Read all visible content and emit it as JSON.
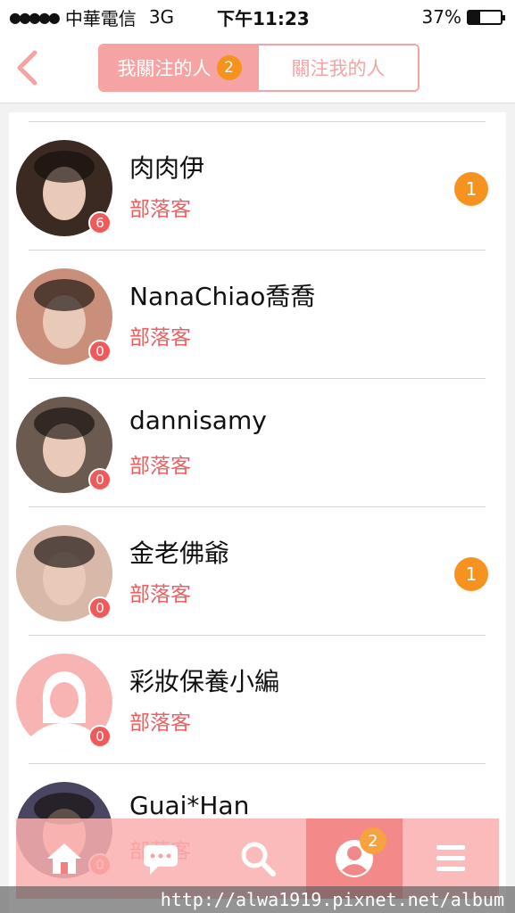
{
  "status_bar": {
    "signal_dots": "●●●●●",
    "carrier": "中華電信",
    "network": "3G",
    "time": "下午11:23",
    "battery_percent": "37%",
    "battery_level": 0.37
  },
  "header": {
    "tabs": [
      {
        "label": "我關注的人",
        "badge": "2",
        "active": true
      },
      {
        "label": "關注我的人",
        "active": false
      }
    ]
  },
  "list": [
    {
      "name": "肉肉伊",
      "role": "部落客",
      "count": "6",
      "notification": "1",
      "avatar_color": "#3a2a22"
    },
    {
      "name": "NanaChiao喬喬",
      "role": "部落客",
      "count": "0",
      "notification": null,
      "avatar_color": "#c98f7a"
    },
    {
      "name": "dannisamy",
      "role": "部落客",
      "count": "0",
      "notification": null,
      "avatar_color": "#6b5a50"
    },
    {
      "name": "金老佛爺",
      "role": "部落客",
      "count": "0",
      "notification": "1",
      "avatar_color": "#d8b8a8"
    },
    {
      "name": "彩妝保養小編",
      "role": "部落客",
      "count": "0",
      "notification": null,
      "avatar_color": "#f7b4b2"
    },
    {
      "name": "Guai*Han",
      "role": "部落客",
      "count": "0",
      "notification": null,
      "avatar_color": "#4a4560"
    }
  ],
  "tab_bar": {
    "items": [
      {
        "icon": "home-icon",
        "active": false
      },
      {
        "icon": "chat-icon",
        "active": false
      },
      {
        "icon": "search-icon",
        "active": false
      },
      {
        "icon": "profile-icon",
        "active": true,
        "badge": "2"
      },
      {
        "icon": "menu-icon",
        "active": false
      }
    ]
  },
  "watermark": "http://alwa1919.pixnet.net/album",
  "colors": {
    "accent": "#f5a3a3",
    "role_text": "#ee6060",
    "badge_orange": "#f6921e",
    "count_badge": "#ef5a5a"
  }
}
